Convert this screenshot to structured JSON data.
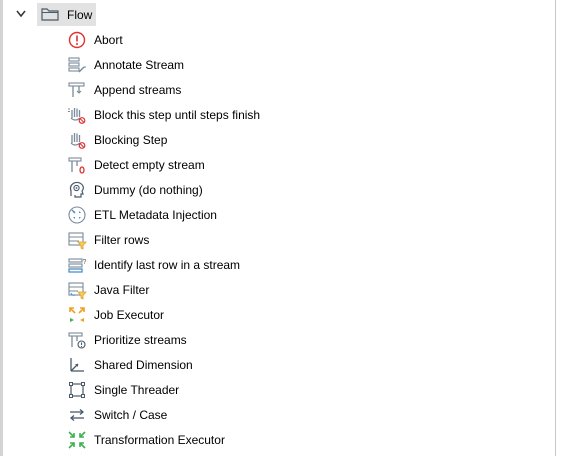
{
  "category": {
    "label": "Flow",
    "expanded": true,
    "chevron_icon": "chevron-down-icon",
    "folder_icon": "folder-icon"
  },
  "items": [
    {
      "label": "Abort",
      "icon": "abort-icon"
    },
    {
      "label": "Annotate Stream",
      "icon": "annotate-stream-icon"
    },
    {
      "label": "Append streams",
      "icon": "append-streams-icon"
    },
    {
      "label": "Block this step until steps finish",
      "icon": "block-until-steps-finish-icon"
    },
    {
      "label": "Blocking Step",
      "icon": "blocking-step-icon"
    },
    {
      "label": "Detect empty stream",
      "icon": "detect-empty-stream-icon"
    },
    {
      "label": "Dummy (do nothing)",
      "icon": "dummy-icon"
    },
    {
      "label": "ETL Metadata Injection",
      "icon": "etl-metadata-injection-icon"
    },
    {
      "label": "Filter rows",
      "icon": "filter-rows-icon"
    },
    {
      "label": "Identify last row in a stream",
      "icon": "identify-last-row-icon"
    },
    {
      "label": "Java Filter",
      "icon": "java-filter-icon"
    },
    {
      "label": "Job Executor",
      "icon": "job-executor-icon"
    },
    {
      "label": "Prioritize streams",
      "icon": "prioritize-streams-icon"
    },
    {
      "label": "Shared Dimension",
      "icon": "shared-dimension-icon"
    },
    {
      "label": "Single Threader",
      "icon": "single-threader-icon"
    },
    {
      "label": "Switch / Case",
      "icon": "switch-case-icon"
    },
    {
      "label": "Transformation Executor",
      "icon": "transformation-executor-icon"
    }
  ],
  "colors": {
    "selection_bg": "#e2e2e2",
    "icon_gray": "#7a8a9a",
    "icon_blue": "#4a90c8",
    "icon_red": "#e03030",
    "icon_orange": "#f0a020",
    "icon_green": "#3cb050"
  }
}
